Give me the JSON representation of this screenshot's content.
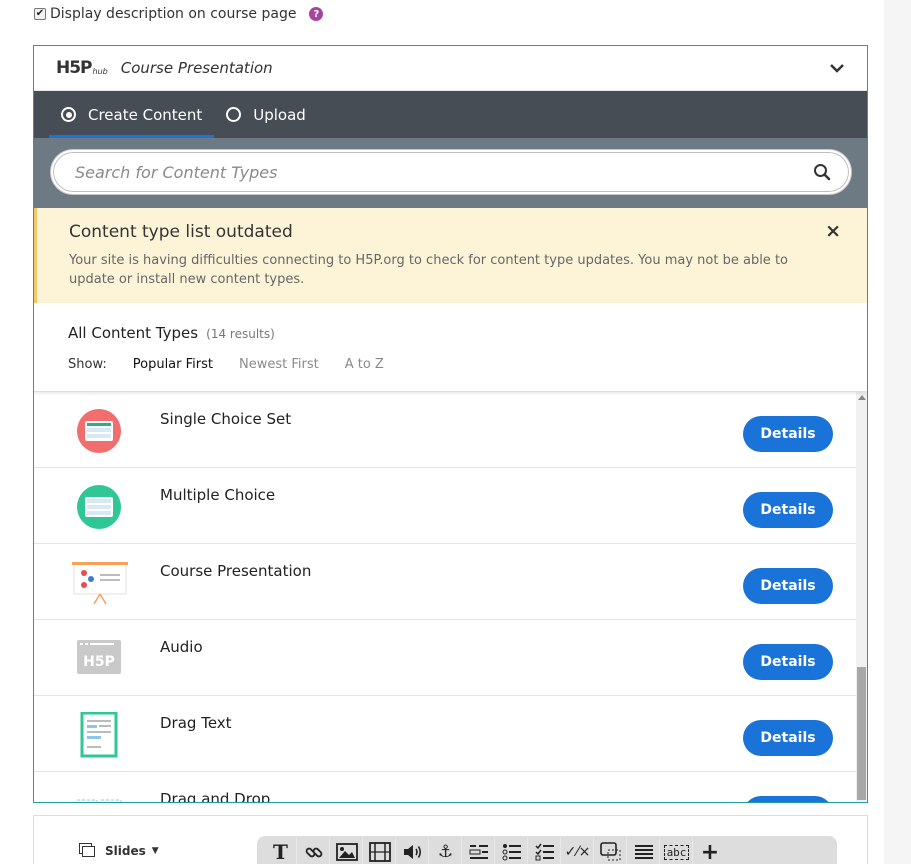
{
  "settings": {
    "display_description_label": "Display description on course page",
    "display_description_checked": true
  },
  "hub": {
    "logo_text": "H5P",
    "logo_sub": "hub",
    "title": "Course Presentation",
    "tabs": [
      {
        "label": "Create Content",
        "selected": true
      },
      {
        "label": "Upload",
        "selected": false
      }
    ],
    "search_placeholder": "Search for Content Types",
    "warning": {
      "title": "Content type list outdated",
      "text": "Your site is having difficulties connecting to H5P.org to check for content type updates. You may not be able to update or install new content types."
    },
    "list_title": "All Content Types",
    "result_count": "(14 results)",
    "show_label": "Show:",
    "sort_options": [
      {
        "label": "Popular First",
        "active": true
      },
      {
        "label": "Newest First",
        "active": false
      },
      {
        "label": "A to Z",
        "active": false
      }
    ],
    "details_label": "Details",
    "content_types": [
      {
        "name": "Single Choice Set",
        "icon": "single-choice-set-icon"
      },
      {
        "name": "Multiple Choice",
        "icon": "multiple-choice-icon"
      },
      {
        "name": "Course Presentation",
        "icon": "course-presentation-icon"
      },
      {
        "name": "Audio",
        "icon": "audio-icon"
      },
      {
        "name": "Drag Text",
        "icon": "drag-text-icon"
      },
      {
        "name": "Drag and Drop",
        "icon": "drag-and-drop-icon"
      }
    ]
  },
  "editor": {
    "slides_label": "Slides",
    "tools": [
      "text-icon",
      "link-icon",
      "image-icon",
      "video-icon",
      "audio-icon",
      "anchor-icon",
      "fill-blanks-icon",
      "single-choice-icon",
      "multiple-choice-icon",
      "true-false-icon",
      "drag-drop-icon",
      "summary-icon",
      "drag-text-icon",
      "add-icon"
    ]
  },
  "colors": {
    "accent": "#1a73d9",
    "tab_bar": "#474d55",
    "search_band": "#6d7983",
    "warning_bg": "#fdf4d8",
    "hub_border": "#1f9ea8",
    "help_icon": "#a7459c"
  }
}
